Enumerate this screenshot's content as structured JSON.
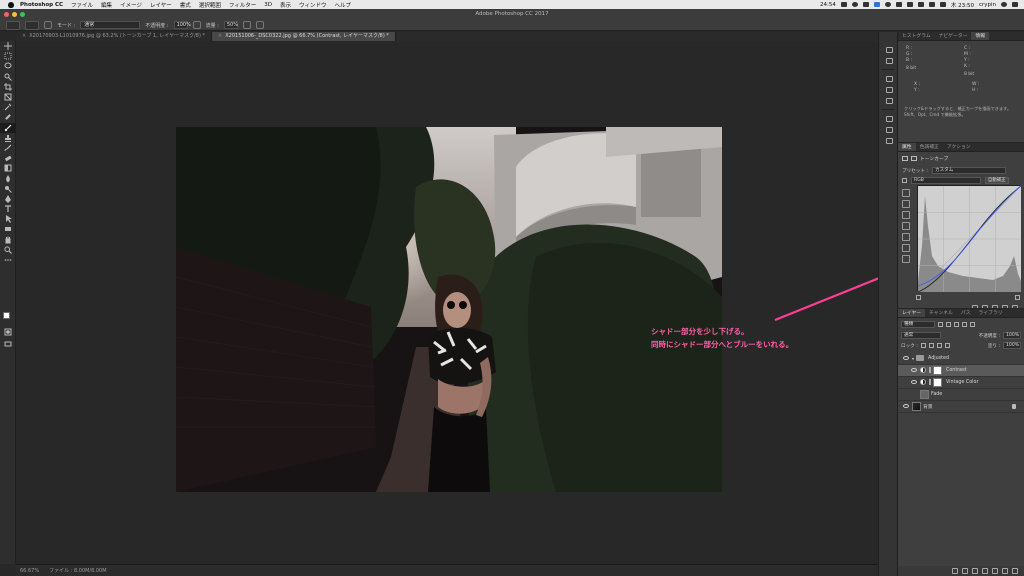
{
  "menubar": {
    "items": [
      "Photoshop CC",
      "ファイル",
      "編集",
      "イメージ",
      "レイヤー",
      "書式",
      "選択範囲",
      "フィルター",
      "3D",
      "表示",
      "ウィンドウ",
      "ヘルプ"
    ],
    "status_time_left": "24:54",
    "clock": "木 23:50",
    "user": "crypin"
  },
  "window": {
    "title": "Adobe Photoshop CC 2017"
  },
  "options": {
    "mode_label": "モード :",
    "mode_value": "通常",
    "opacity_label": "不透明度 :",
    "opacity_value": "100%",
    "flow_label": "流量 :",
    "flow_value": "50%"
  },
  "tabs": [
    {
      "label": "X20170903-L1010976.jpg @ 63.2% (トーンカーブ 1, レイヤーマスク/8) *",
      "active": false
    },
    {
      "label": "X20151006-_DSC0322.jpg @ 66.7% (Contrast, レイヤーマスク/8) *",
      "active": true
    }
  ],
  "status": {
    "zoom": "66.67%",
    "doc": "ファイル : 8.00M/8.00M"
  },
  "annotation": {
    "line1": "シャドー部分を少し下げる。",
    "line2": "同時にシャドー部分へとブルーをいれる。",
    "color": "#ff5fa8"
  },
  "info_panel": {
    "tabs": [
      "ヒストグラム",
      "ナビゲーター",
      "情報"
    ],
    "cells": [
      "R :",
      "G :",
      "B :",
      "8 bit",
      "C :",
      "M :",
      "Y :",
      "K :",
      "8 bit",
      "X :",
      "Y :",
      "W :",
      "H :"
    ],
    "hint": "クリック&ドラッグすると、補正カーブを描画できます。Shift、Opt、Cmd で機能拡張。"
  },
  "properties": {
    "tabs": [
      "属性",
      "色調補正",
      "アクション"
    ],
    "title": "トーンカーブ",
    "preset_label": "プリセット :",
    "preset_value": "カスタム",
    "channel_value": "RGB",
    "auto_label": "自動補正"
  },
  "layers": {
    "tabs": [
      "レイヤー",
      "チャンネル",
      "パス",
      "ライブラリ"
    ],
    "kind_value": "種類",
    "blend_value": "通常",
    "opacity_label": "不透明度 :",
    "opacity_value": "100%",
    "lock_label": "ロック :",
    "fill_label": "塗り :",
    "fill_value": "100%",
    "list": [
      {
        "name": "Adjusted",
        "type": "group"
      },
      {
        "name": "Contrast",
        "type": "adjustment"
      },
      {
        "name": "Vintage Color",
        "type": "adjustment"
      },
      {
        "name": "Fade",
        "type": "layer"
      },
      {
        "name": "背景",
        "type": "background"
      }
    ]
  },
  "colors": {
    "accent": "#ff5fa8",
    "panel": "#3f3f3f",
    "canvas": "#282828"
  }
}
